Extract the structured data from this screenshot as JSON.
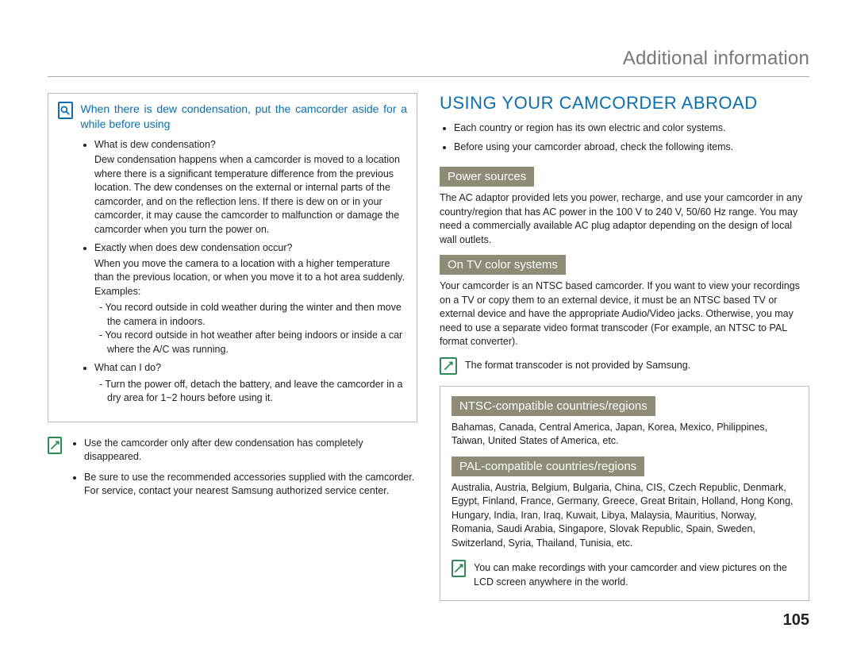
{
  "header": {
    "title": "Additional information"
  },
  "pageNumber": "105",
  "left": {
    "infoBox": {
      "lead": "When there is dew condensation, put the camcorder aside for a while before using",
      "items": [
        {
          "q": "What is dew condensation?",
          "body": "Dew condensation happens when a camcorder is moved to a location where there is a significant temperature difference from the previous location. The dew condenses on the external or internal parts of the camcorder, and on the reflection lens. If there is dew on or in your camcorder, it may cause the camcorder to malfunction or damage the camcorder when you turn the power on."
        },
        {
          "q": "Exactly when does dew condensation occur?",
          "body": "When you move the camera to a location with a higher temperature than the previous location, or when you move it to a hot area suddenly. Examples:",
          "dashes": [
            "You record outside in cold weather during the winter and then move the camera in indoors.",
            "You record outside in hot weather after being indoors or inside a car where the A/C was running."
          ]
        },
        {
          "q": "What can I do?",
          "dashes": [
            "Turn the power off, detach the battery, and leave the camcorder in a dry area for 1~2 hours before using it."
          ]
        }
      ]
    },
    "notes": [
      "Use the camcorder only after dew condensation has completely disappeared.",
      "Be sure to use the recommended accessories supplied with the camcorder. For service, contact your nearest Samsung authorized service center."
    ]
  },
  "right": {
    "h1": "USING YOUR CAMCORDER ABROAD",
    "introBullets": [
      "Each country or region has its own electric and color systems.",
      "Before using your camcorder abroad, check the following items."
    ],
    "power": {
      "label": "Power sources",
      "body": "The AC adaptor provided lets you power, recharge, and use your camcorder in any country/region that has AC power in the 100 V to 240 V, 50/60 Hz range. You may need a commercially available AC plug adaptor depending on the design of local wall outlets."
    },
    "tv": {
      "label": "On TV color systems",
      "body": "Your camcorder is an NTSC based camcorder. If you want to view your recordings on a TV or copy them to an external device, it must be an NTSC based TV or external device and have the appropriate Audio/Video jacks. Otherwise, you may need to use a separate video format transcoder (For example, an NTSC to PAL format converter).",
      "note": "The format transcoder is not provided by Samsung."
    },
    "ntsc": {
      "label": "NTSC-compatible countries/regions",
      "body": "Bahamas, Canada, Central America, Japan, Korea, Mexico, Philippines, Taiwan, United States of America, etc."
    },
    "pal": {
      "label": "PAL-compatible countries/regions",
      "body": "Australia, Austria, Belgium, Bulgaria, China, CIS, Czech Republic, Denmark, Egypt, Finland, France, Germany, Greece, Great Britain, Holland, Hong Kong, Hungary, India, Iran, Iraq, Kuwait, Libya, Malaysia, Mauritius, Norway, Romania, Saudi Arabia, Singapore, Slovak Republic, Spain, Sweden, Switzerland, Syria, Thailand, Tunisia, etc."
    },
    "bottomNote": "You can make recordings with your camcorder and view pictures on the LCD screen anywhere in the world."
  }
}
